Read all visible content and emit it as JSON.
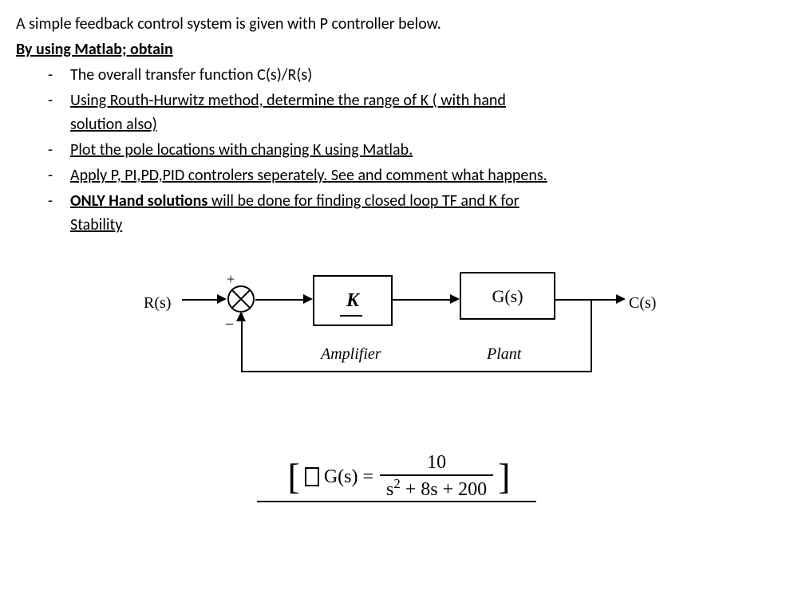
{
  "intro": "A simple feedback control system is given with P controller below.",
  "subhead": "By using Matlab; obtain",
  "tasks": {
    "t1": "The overall transfer function C(s)/R(s)",
    "t2a": "Using Routh-Hurwitz method, determine the range of K ( with hand",
    "t2b": "solution also)",
    "t3": "Plot the pole locations with changing K using Matlab.",
    "t4": "Apply P, PI,PD,PID controlers seperately. See and comment what happens.",
    "t5a": "ONLY Hand solutions",
    "t5b": " will be done for finding closed loop TF and K for",
    "t5c": "Stability"
  },
  "diagram": {
    "input": "R(s)",
    "output": "C(s)",
    "kbox": "K",
    "gbox": "G(s)",
    "amp_label": "Amplifier",
    "plant_label": "Plant",
    "plus": "+",
    "minus": "−"
  },
  "equation": {
    "lhs": "G(s) =",
    "num": "10",
    "den_a": "s",
    "den_sup": "2",
    "den_b": " + 8s + 200"
  }
}
